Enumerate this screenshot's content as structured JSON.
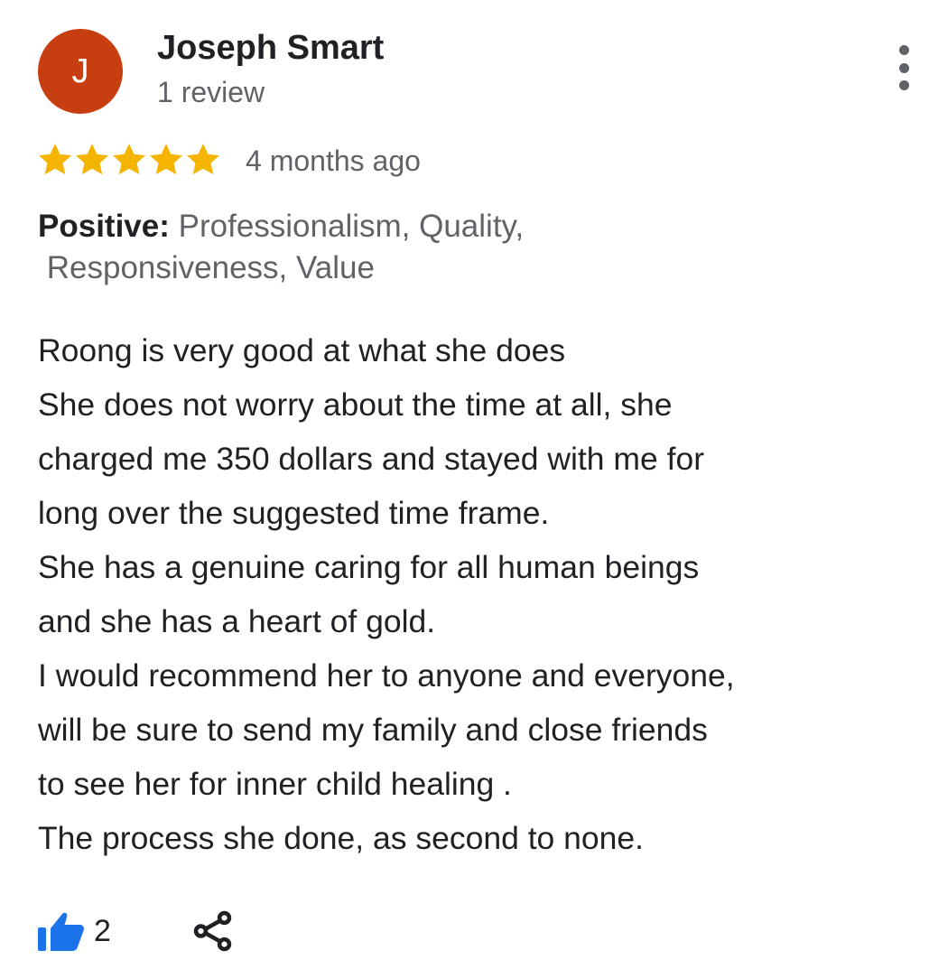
{
  "review": {
    "author": {
      "initial": "J",
      "name": "Joseph Smart",
      "review_count": "1 review",
      "avatar_color": "#c73e10"
    },
    "rating": {
      "value": 5,
      "max": 5,
      "star_color": "#f4b400"
    },
    "time_ago": "4 months ago",
    "attributes": {
      "label": "Positive:",
      "line1": "Professionalism, Quality,",
      "line2": "Responsiveness, Value"
    },
    "text_lines": [
      "Roong is very good at what she does",
      "She does not worry about the time at all, she",
      "charged me 350 dollars and stayed with me for",
      "long over the suggested time frame.",
      "She has a genuine caring for all human beings",
      "and she has a heart of gold.",
      "I would recommend her to anyone and everyone,",
      "will be sure to send my family and close friends",
      "to see her for inner child healing .",
      "The process she done, as second to none."
    ],
    "likes": "2",
    "like_color": "#1a73e8"
  },
  "icons": {
    "menu": "more-vert-icon",
    "like": "thumbs-up-icon",
    "share": "share-icon",
    "star": "star-icon"
  }
}
